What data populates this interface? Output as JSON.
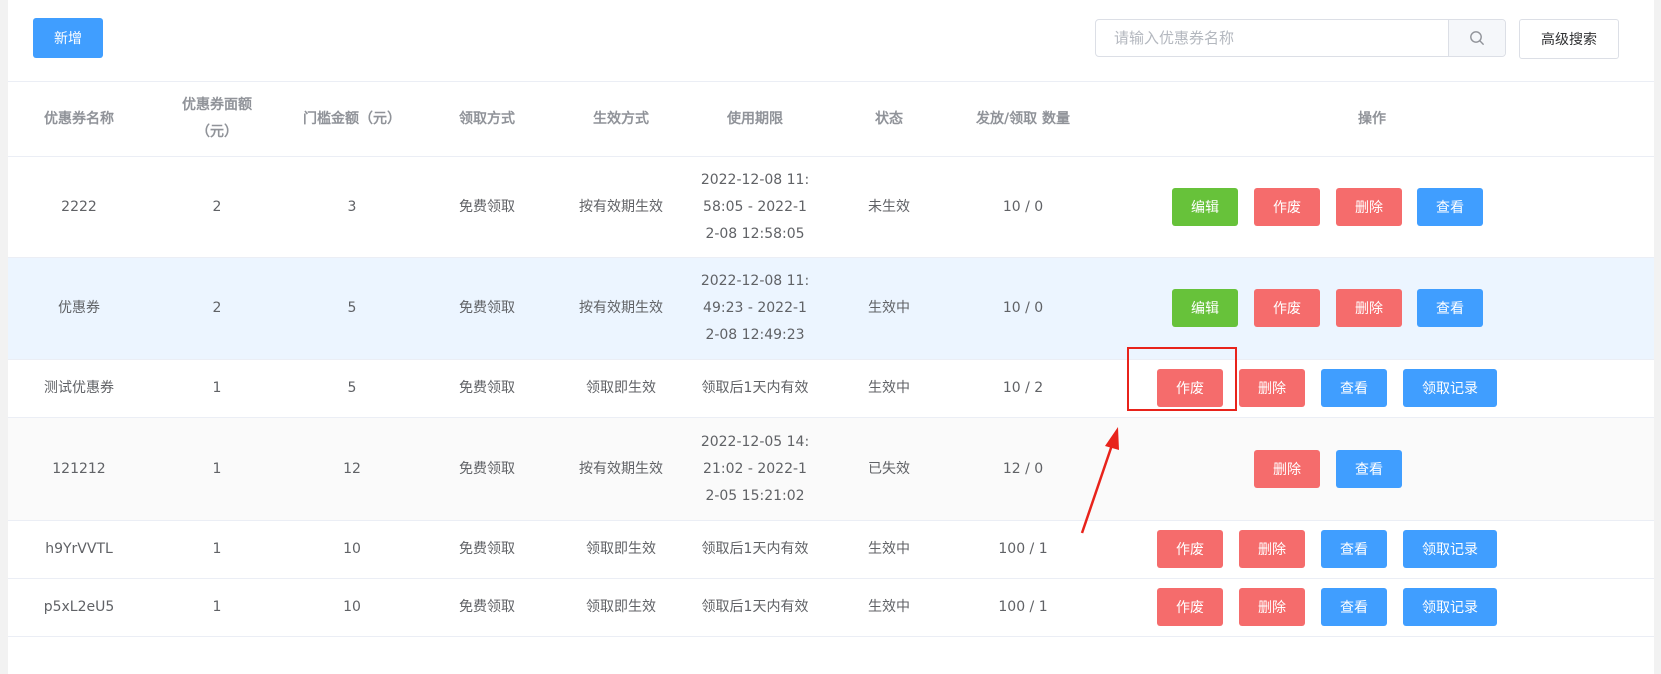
{
  "toolbar": {
    "add_label": "新增",
    "search_placeholder": "请输入优惠券名称",
    "search_value": "",
    "advanced_label": "高级搜索"
  },
  "columns": {
    "name": "优惠券名称",
    "face": "优惠券面额（元）",
    "threshold": "门槛金额（元）",
    "receive": "领取方式",
    "effect": "生效方式",
    "period": "使用期限",
    "status": "状态",
    "qty": "发放/领取 数量",
    "ops": "操作"
  },
  "ops_labels": {
    "edit": "编辑",
    "void": "作废",
    "delete": "删除",
    "view": "查看",
    "records": "领取记录"
  },
  "rows": [
    {
      "name": "2222",
      "face": "2",
      "threshold": "3",
      "receive": "免费领取",
      "effect": "按有效期生效",
      "period": "2022-12-08 11:58:05 - 2022-12-08 12:58:05",
      "status": "未生效",
      "qty": "10 / 0"
    },
    {
      "name": "优惠券",
      "face": "2",
      "threshold": "5",
      "receive": "免费领取",
      "effect": "按有效期生效",
      "period": "2022-12-08 11:49:23 - 2022-12-08 12:49:23",
      "status": "生效中",
      "qty": "10 / 0"
    },
    {
      "name": "测试优惠券",
      "face": "1",
      "threshold": "5",
      "receive": "免费领取",
      "effect": "领取即生效",
      "period": "领取后1天内有效",
      "status": "生效中",
      "qty": "10 / 2"
    },
    {
      "name": "121212",
      "face": "1",
      "threshold": "12",
      "receive": "免费领取",
      "effect": "按有效期生效",
      "period": "2022-12-05 14:21:02 - 2022-12-05 15:21:02",
      "status": "已失效",
      "qty": "12 / 0"
    },
    {
      "name": "h9YrVVTL",
      "face": "1",
      "threshold": "10",
      "receive": "免费领取",
      "effect": "领取即生效",
      "period": "领取后1天内有效",
      "status": "生效中",
      "qty": "100 / 1"
    },
    {
      "name": "p5xL2eU5",
      "face": "1",
      "threshold": "10",
      "receive": "免费领取",
      "effect": "领取即生效",
      "period": "领取后1天内有效",
      "status": "生效中",
      "qty": "100 / 1"
    }
  ],
  "colors": {
    "primary": "#409eff",
    "success": "#67c23a",
    "danger": "#f56c6c",
    "annotation": "#e8231b"
  },
  "icons": {
    "search": "search-icon"
  }
}
